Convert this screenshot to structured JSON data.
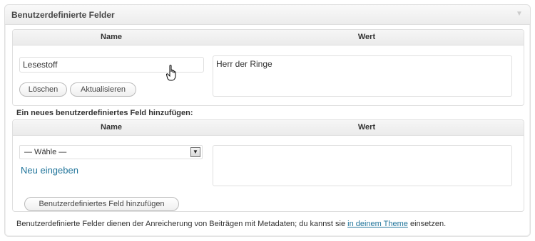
{
  "panel": {
    "title": "Benutzerdefinierte Felder",
    "toggle_icon": "triangle-down-icon"
  },
  "existing_fields": {
    "headers": {
      "name": "Name",
      "value": "Wert"
    },
    "row": {
      "name_value": "Lesestoff",
      "value_value": "Herr der Ringe",
      "delete_label": "Löschen",
      "update_label": "Aktualisieren"
    }
  },
  "new_field": {
    "heading": "Ein neues benutzerdefiniertes Feld hinzufügen:",
    "headers": {
      "name": "Name",
      "value": "Wert"
    },
    "select_value": "— Wähle —",
    "enter_new_label": "Neu eingeben",
    "add_label": "Benutzerdefiniertes Feld hinzufügen"
  },
  "footer": {
    "text_before": "Benutzerdefinierte Felder dienen der Anreicherung von Beiträgen mit Metadaten; du kannst sie ",
    "link_text": "in deinem Theme",
    "text_after": " einsetzen."
  },
  "colors": {
    "link": "#21759b",
    "border": "#dfdfdf",
    "header_bg": "#ececec"
  }
}
